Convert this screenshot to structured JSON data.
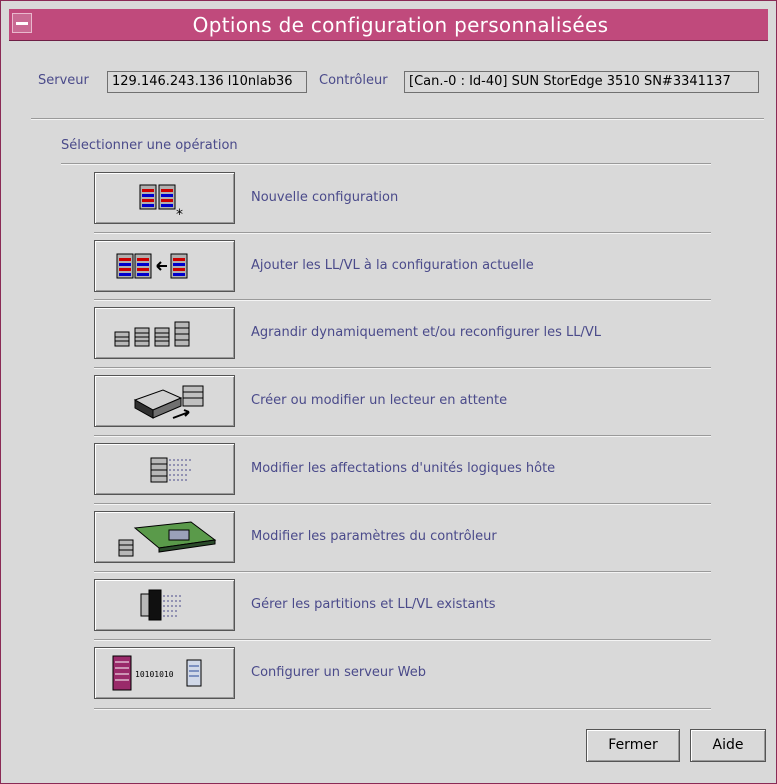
{
  "window": {
    "title": "Options de configuration personnalisées"
  },
  "server": {
    "label": "Serveur",
    "value": "129.146.243.136 l10nlab36"
  },
  "controller": {
    "label": "Contrôleur",
    "value": "[Can.-0 : Id-40] SUN StorEdge 3510 SN#3341137"
  },
  "section_label": "Sélectionner une opération",
  "operations": [
    {
      "label": "Nouvelle configuration",
      "icon": "new-config-icon"
    },
    {
      "label": "Ajouter les LL/VL à la configuration actuelle",
      "icon": "add-ld-icon"
    },
    {
      "label": "Agrandir dynamiquement et/ou reconfigurer les LL/VL",
      "icon": "expand-ld-icon"
    },
    {
      "label": "Créer ou modifier un lecteur en attente",
      "icon": "standby-drive-icon"
    },
    {
      "label": "Modifier les affectations d'unités logiques hôte",
      "icon": "host-lun-icon"
    },
    {
      "label": "Modifier les paramètres du contrôleur",
      "icon": "controller-params-icon"
    },
    {
      "label": "Gérer les partitions et LL/VL existants",
      "icon": "partitions-icon"
    },
    {
      "label": "Configurer un serveur Web",
      "icon": "web-server-icon"
    }
  ],
  "buttons": {
    "close": "Fermer",
    "help": "Aide"
  },
  "colors": {
    "title_bar": "#c04a7c",
    "label_text": "#4a4a8a",
    "background": "#d9d9d9"
  }
}
